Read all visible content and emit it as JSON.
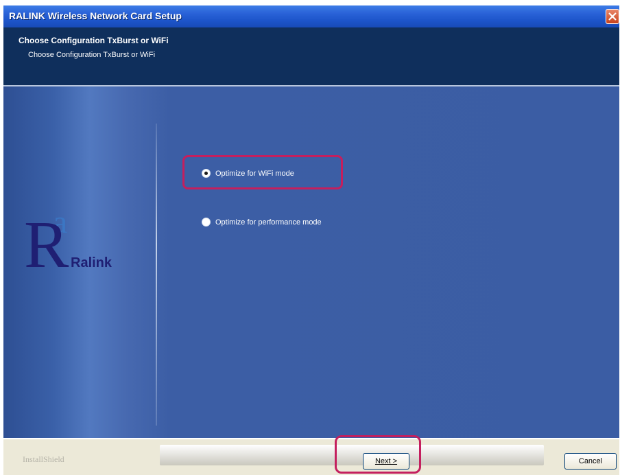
{
  "window": {
    "title": "RALINK Wireless Network Card Setup"
  },
  "header": {
    "title": "Choose Configuration TxBurst or WiFi",
    "subtitle": "Choose Configuration TxBurst or WiFi"
  },
  "logo": {
    "letter": "R",
    "brand": "Ralink"
  },
  "options": [
    {
      "label": "Optimize for WiFi mode",
      "selected": true
    },
    {
      "label": "Optimize for performance mode",
      "selected": false
    }
  ],
  "footer": {
    "brand": "InstallShield",
    "next_label": "Next >",
    "cancel_label": "Cancel"
  },
  "colors": {
    "titlebar": "#2a63d8",
    "header": "#0f2f5c",
    "content": "#3b5da4",
    "highlight": "#c41f5e",
    "footer": "#ece9d8"
  },
  "icons": {
    "close": "close-icon",
    "radio": "radio-icon"
  }
}
